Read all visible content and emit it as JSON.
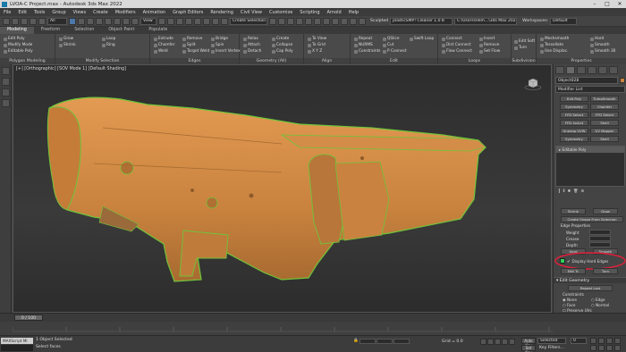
{
  "window": {
    "title": "LVOA-C Project.max - Autodesk 3ds Max 2022"
  },
  "menu": [
    "File",
    "Edit",
    "Tools",
    "Group",
    "Views",
    "Create",
    "Modifiers",
    "Animation",
    "Graph Editors",
    "Rendering",
    "Civil View",
    "Customize",
    "Scripting",
    "Arnold",
    "Help"
  ],
  "toolbar": {
    "filter": "All",
    "selection_set": "Create Selection Se",
    "plugin_label": "Sculpted",
    "plugin_value": "plasticSMP! Cleaner 1.0 8",
    "user_path": "C:\\Users\\Hem...\\3ds Max 2022",
    "workspace_label": "Workspaces:",
    "workspace_value": "Default"
  },
  "ribbon_tabs": [
    "Modeling",
    "Freeform",
    "Selection",
    "Object Paint",
    "Populate"
  ],
  "ribbon_groups": [
    {
      "label": "Polygon Modeling",
      "items": [
        "Edit Poly",
        "Modify Mode",
        "Editable Poly"
      ]
    },
    {
      "label": "Modify Selection",
      "items": [
        "Grow",
        "Shrink",
        "Loop",
        "Ring"
      ]
    },
    {
      "label": "Edges",
      "items": [
        "Extrude",
        "Chamfer",
        "Weld",
        "Remove",
        "Split",
        "Target Weld",
        "Bridge",
        "Spin",
        "Insert Vertex"
      ]
    },
    {
      "label": "Geometry (All)",
      "items": [
        "Relax",
        "Attach",
        "Detach",
        "Create",
        "Collapse",
        "Cap Poly"
      ]
    },
    {
      "label": "Align",
      "items": [
        "To View",
        "To Grid",
        "X Y Z"
      ]
    },
    {
      "label": "Edit",
      "items": [
        "Repeat",
        "NURMS",
        "Constraints",
        "QSlice",
        "Cut",
        "P Connect",
        "Swift Loop"
      ]
    },
    {
      "label": "Loops",
      "items": [
        "Connect",
        "Dist Connect",
        "Flow Connect",
        "Insert",
        "Remove",
        "Set Flow"
      ]
    },
    {
      "label": "Subdivision",
      "items": [
        "Edit Soft",
        "Turn"
      ]
    },
    {
      "label": "Properties",
      "items": [
        "Meshsmooth",
        "Tessellate",
        "Use Displac.",
        "Hard",
        "Smooth",
        "Smooth 30"
      ]
    }
  ],
  "viewport": {
    "label": "[+] [Orthographic] [SOV Mode 1] [Default Shading]"
  },
  "command_panel": {
    "object_name": "Object028",
    "modifier_list": "Modifier List",
    "modifier_buttons": [
      "Edit Poly",
      "TurboSmooth",
      "Symmetry",
      "Chamfer",
      "FFD Select",
      "FFD Select",
      "FFD 4x4x4",
      "Shell",
      "Unwrap UVW",
      "UV Mapper",
      "Symmetry",
      "Shell"
    ],
    "stack_item": "Editable Poly",
    "selection_buttons": [
      "Shrink",
      "Grow"
    ],
    "create_shape": "Create Shape From Selection",
    "edge_properties": "Edge Properties",
    "weight_label": "Weight",
    "crease_label": "Crease",
    "depth_label": "Depth",
    "hard_label": "Hard",
    "smooth_label": "Smooth",
    "display_hard_edges": "Display Hard Edges",
    "display_hard_edges_checked": true,
    "edge_btn_1": "Edit Tr.",
    "edge_btn_2": "Turn",
    "edit_geometry": "Edit Geometry",
    "repeat_last": "Repeat Last",
    "constraints_label": "Constraints",
    "constraint_options": [
      "None",
      "Edge",
      "Face",
      "Normal"
    ],
    "preserve_uvs": "Preserve UVs",
    "highlight_color": "#e0203a",
    "swatch_color": "#2fd35a"
  },
  "timeline": {
    "frame": "0 / 100"
  },
  "status": {
    "maxscript": "MAXScript Mi",
    "selected": "1 Object Selected",
    "hint": "Select faces",
    "grid": "Grid = 0.0",
    "autokey": "Auto Key",
    "selected_dropdown": "Selected",
    "set_key": "Set Key",
    "key_filters": "Key Filters...",
    "frame_value": "0"
  },
  "colors": {
    "model_fill": "#d08a44",
    "model_edge": "#6fc43a"
  }
}
